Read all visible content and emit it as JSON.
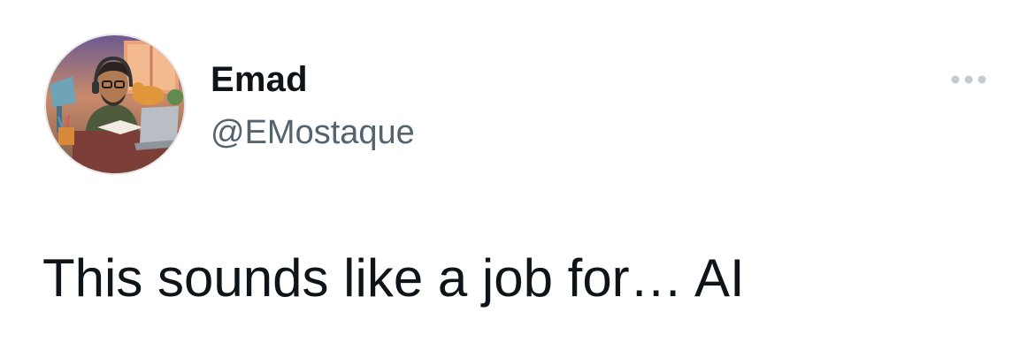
{
  "author": {
    "display_name": "Emad",
    "handle": "@EMostaque",
    "avatar_icon": "bitmoji-avatar-at-desk"
  },
  "tweet": {
    "text": "This sounds like a job for… AI"
  },
  "menu": {
    "icon": "more-options-icon"
  },
  "colors": {
    "primary_text": "#0f1419",
    "secondary_text": "#536471",
    "more_icon": "#c3cad1"
  }
}
